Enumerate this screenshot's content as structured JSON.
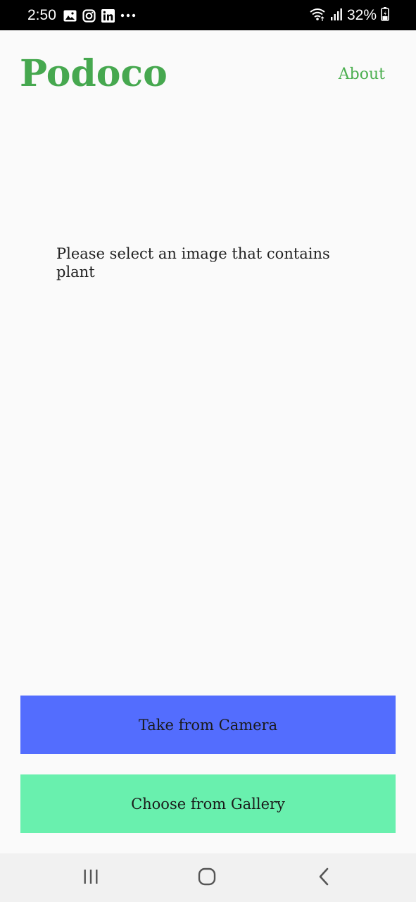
{
  "status_bar": {
    "time": "2:50",
    "battery": "32%",
    "left_icons": [
      "gallery-icon",
      "instagram-icon",
      "linkedin-icon",
      "more-dots-icon"
    ],
    "right_icons": [
      "wifi-icon",
      "signal-icon",
      "battery-icon"
    ]
  },
  "header": {
    "title": "Podoco",
    "about_label": "About"
  },
  "main": {
    "prompt": "Please select an image that contains plant"
  },
  "actions": {
    "camera_label": "Take from Camera",
    "gallery_label": "Choose from Gallery"
  },
  "nav": {
    "icons": [
      "recents-icon",
      "home-icon",
      "back-icon"
    ]
  },
  "colors": {
    "brand": "#46a84f",
    "camera_button": "#536dfe",
    "gallery_button": "#69f0ae",
    "background": "#fafafa"
  }
}
